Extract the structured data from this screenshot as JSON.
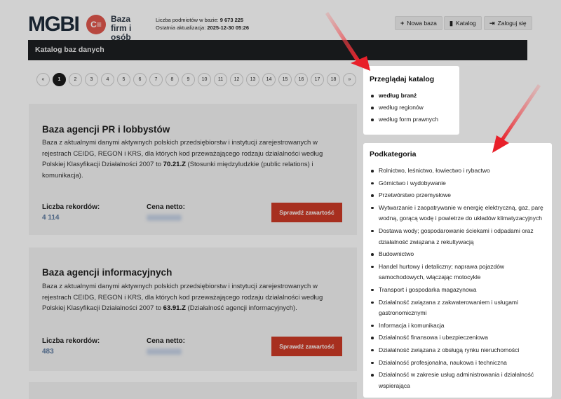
{
  "header": {
    "logo_text": "MGBI",
    "logo_badge": "C≡",
    "logo_sub": "Baza firm i osób",
    "stats": {
      "count_label": "Liczba podmiotów w bazie:",
      "count_value": "9 673 225",
      "update_label": "Ostatnia aktualizacja:",
      "update_value": "2025-12-30 05:26"
    },
    "buttons": {
      "new_base": "Nowa baza",
      "catalog": "Katalog",
      "login": "Zaloguj się"
    }
  },
  "darkbar": {
    "title": "Katalog baz danych"
  },
  "pagination": {
    "prev": "«",
    "next": "»",
    "pages": [
      "1",
      "2",
      "3",
      "4",
      "5",
      "6",
      "7",
      "8",
      "9",
      "10",
      "11",
      "12",
      "13",
      "14",
      "15",
      "16",
      "17",
      "18"
    ],
    "current": "1"
  },
  "cards": [
    {
      "title": "Baza agencji PR i lobbystów",
      "desc_pre": "Baza z aktualnymi danymi aktywnych polskich przedsiębiorstw i instytucji zarejestrowanych w rejestrach CEIDG, REGON i KRS, dla których kod przeważającego rodzaju działalności według Polskiej Klasyfikacji Działalności 2007 to ",
      "code": "70.21.Z",
      "desc_post": " (Stosunki międzyludzkie (public relations) i komunikacja).",
      "records_label": "Liczba rekordów:",
      "records_value": "4 114",
      "price_label": "Cena netto:",
      "button": "Sprawdź zawartość"
    },
    {
      "title": "Baza agencji informacyjnych",
      "desc_pre": "Baza z aktualnymi danymi aktywnych polskich przedsiębiorstw i instytucji zarejestrowanych w rejestrach CEIDG, REGON i KRS, dla których kod przeważającego rodzaju działalności według Polskiej Klasyfikacji Działalności 2007 to ",
      "code": "63.91.Z",
      "desc_post": " (Działalność agencji informacyjnych).",
      "records_label": "Liczba rekordów:",
      "records_value": "483",
      "price_label": "Cena netto:",
      "button": "Sprawdź zawartość"
    }
  ],
  "catalog_panel": {
    "title": "Przeglądaj katalog",
    "items": [
      "według branż",
      "według regionów",
      "według form prawnych"
    ],
    "selected": "według branż"
  },
  "subcategory_panel": {
    "title": "Podkategoria",
    "items": [
      "Rolnictwo, leśnictwo, łowiectwo i rybactwo",
      "Górnictwo i wydobywanie",
      "Przetwórstwo przemysłowe",
      "Wytwarzanie i zaopatrywanie w energię elektryczną, gaz, parę wodną, gorącą wodę i powietrze do układów klimatyzacyjnych",
      "Dostawa wody; gospodarowanie ściekami i odpadami oraz działalność związana z rekultywacją",
      "Budownictwo",
      "Handel hurtowy i detaliczny; naprawa pojazdów samochodowych, włączając motocykle",
      "Transport i gospodarka magazynowa",
      "Działalność związana z zakwaterowaniem i usługami gastronomicznymi",
      "Informacja i komunikacja",
      "Działalność finansowa i ubezpieczeniowa",
      "Działalność związana z obsługą rynku nieruchomości",
      "Działalność profesjonalna, naukowa i techniczna",
      "Działalność w zakresie usług administrowania i działalność wspierająca"
    ]
  },
  "colors": {
    "accent": "#cc3a26",
    "arrow": "#e8202a",
    "darkbar": "#1d1f22",
    "value_blue": "#5d7aa0"
  },
  "icons": {
    "new_base": "plus-icon",
    "catalog": "book-icon",
    "login": "login-icon"
  }
}
